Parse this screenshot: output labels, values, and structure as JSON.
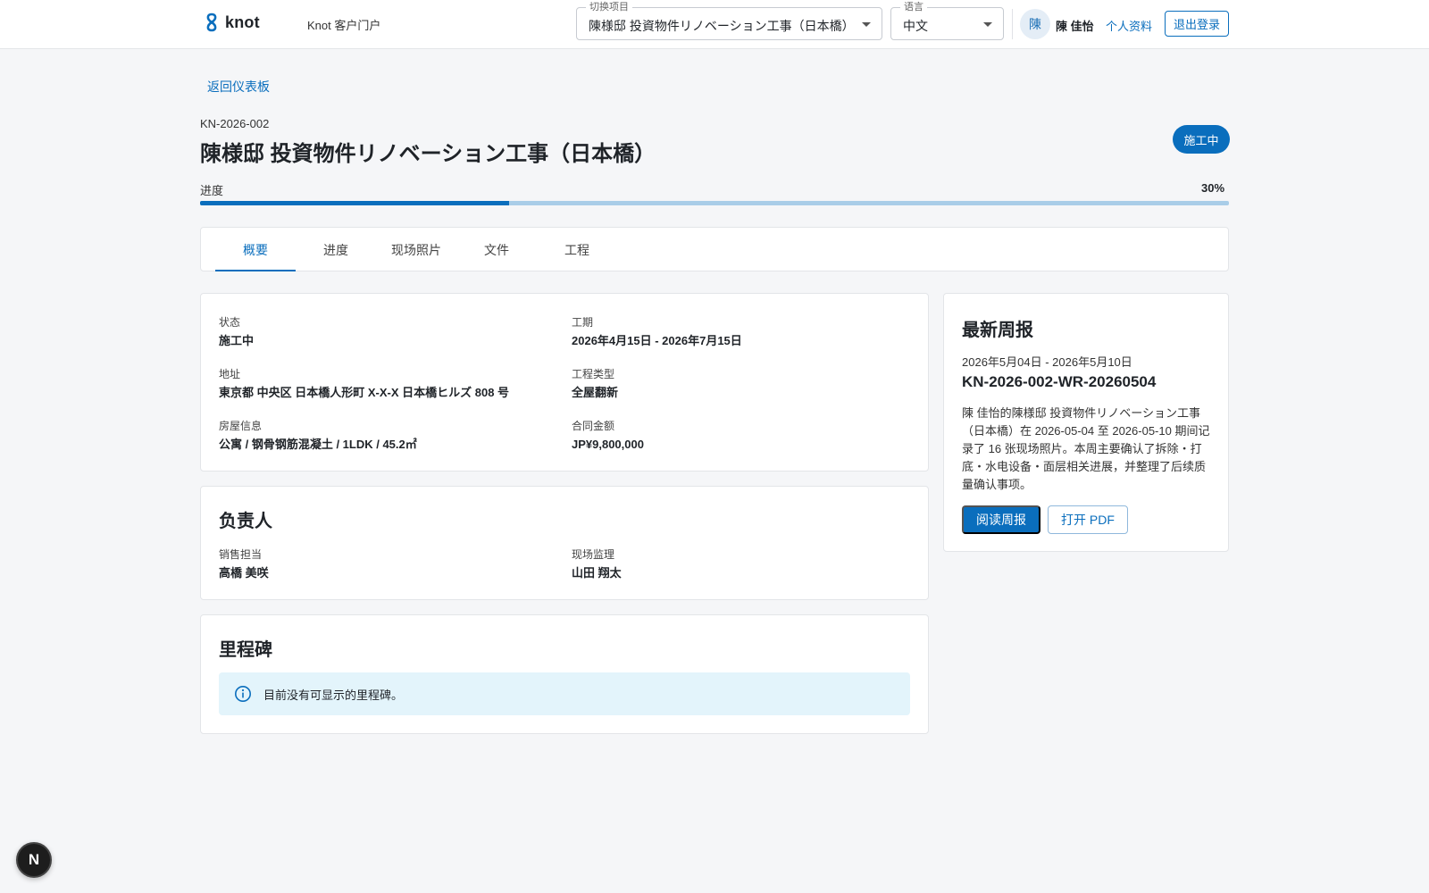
{
  "header": {
    "logo_text": "knot",
    "portal_name": "Knot 客户门户",
    "project_select": {
      "legend": "切换项目",
      "value": "陳様邸 投資物件リノベーション工事（日本橋）"
    },
    "language_select": {
      "legend": "语言",
      "value": "中文"
    },
    "user": {
      "avatar_initial": "陳",
      "name": "陳 佳怡"
    },
    "profile_label": "个人资料",
    "logout_label": "退出登录"
  },
  "back_label": "返回仪表板",
  "project": {
    "code": "KN-2026-002",
    "title": "陳様邸 投資物件リノベーション工事（日本橋）",
    "status_chip": "施工中",
    "progress_label": "进度",
    "progress_text": "30%",
    "progress_percent": 30
  },
  "tabs": [
    {
      "label": "概要",
      "active": true
    },
    {
      "label": "进度",
      "active": false
    },
    {
      "label": "现场照片",
      "active": false
    },
    {
      "label": "文件",
      "active": false
    },
    {
      "label": "工程",
      "active": false
    }
  ],
  "overview": {
    "status": {
      "label": "状态",
      "value": "施工中"
    },
    "period": {
      "label": "工期",
      "value": "2026年4月15日 - 2026年7月15日"
    },
    "address": {
      "label": "地址",
      "value": "東京都 中央区 日本橋人形町 X-X-X 日本橋ヒルズ 808 号"
    },
    "work_type": {
      "label": "工程类型",
      "value": "全屋翻新"
    },
    "property": {
      "label": "房屋信息",
      "value": "公寓 / 钢骨钢筋混凝土 / 1LDK / 45.2㎡"
    },
    "contract_amount": {
      "label": "合同金额",
      "value": "JP¥9,800,000"
    }
  },
  "people": {
    "title": "负责人",
    "sales": {
      "label": "销售担当",
      "value": "高橋 美咲"
    },
    "supervisor": {
      "label": "现场监理",
      "value": "山田 翔太"
    }
  },
  "milestones": {
    "title": "里程碑",
    "empty_text": "目前没有可显示的里程碑。"
  },
  "weekly_report": {
    "title": "最新周报",
    "dates": "2026年5月04日 - 2026年5月10日",
    "id": "KN-2026-002-WR-20260504",
    "summary": "陳 佳怡的陳様邸 投資物件リノベーション工事（日本橋）在 2026-05-04 至 2026-05-10 期间记录了 16 张现场照片。本周主要确认了拆除・打底・水电设备・面层相关进展，并整理了后续质量确认事项。",
    "read_label": "阅读周报",
    "pdf_label": "打开 PDF"
  },
  "dev_badge": "N",
  "colors": {
    "accent": "#0a6ebd",
    "progress_track": "#a9cde8",
    "info_bg": "#e3f4fb"
  }
}
